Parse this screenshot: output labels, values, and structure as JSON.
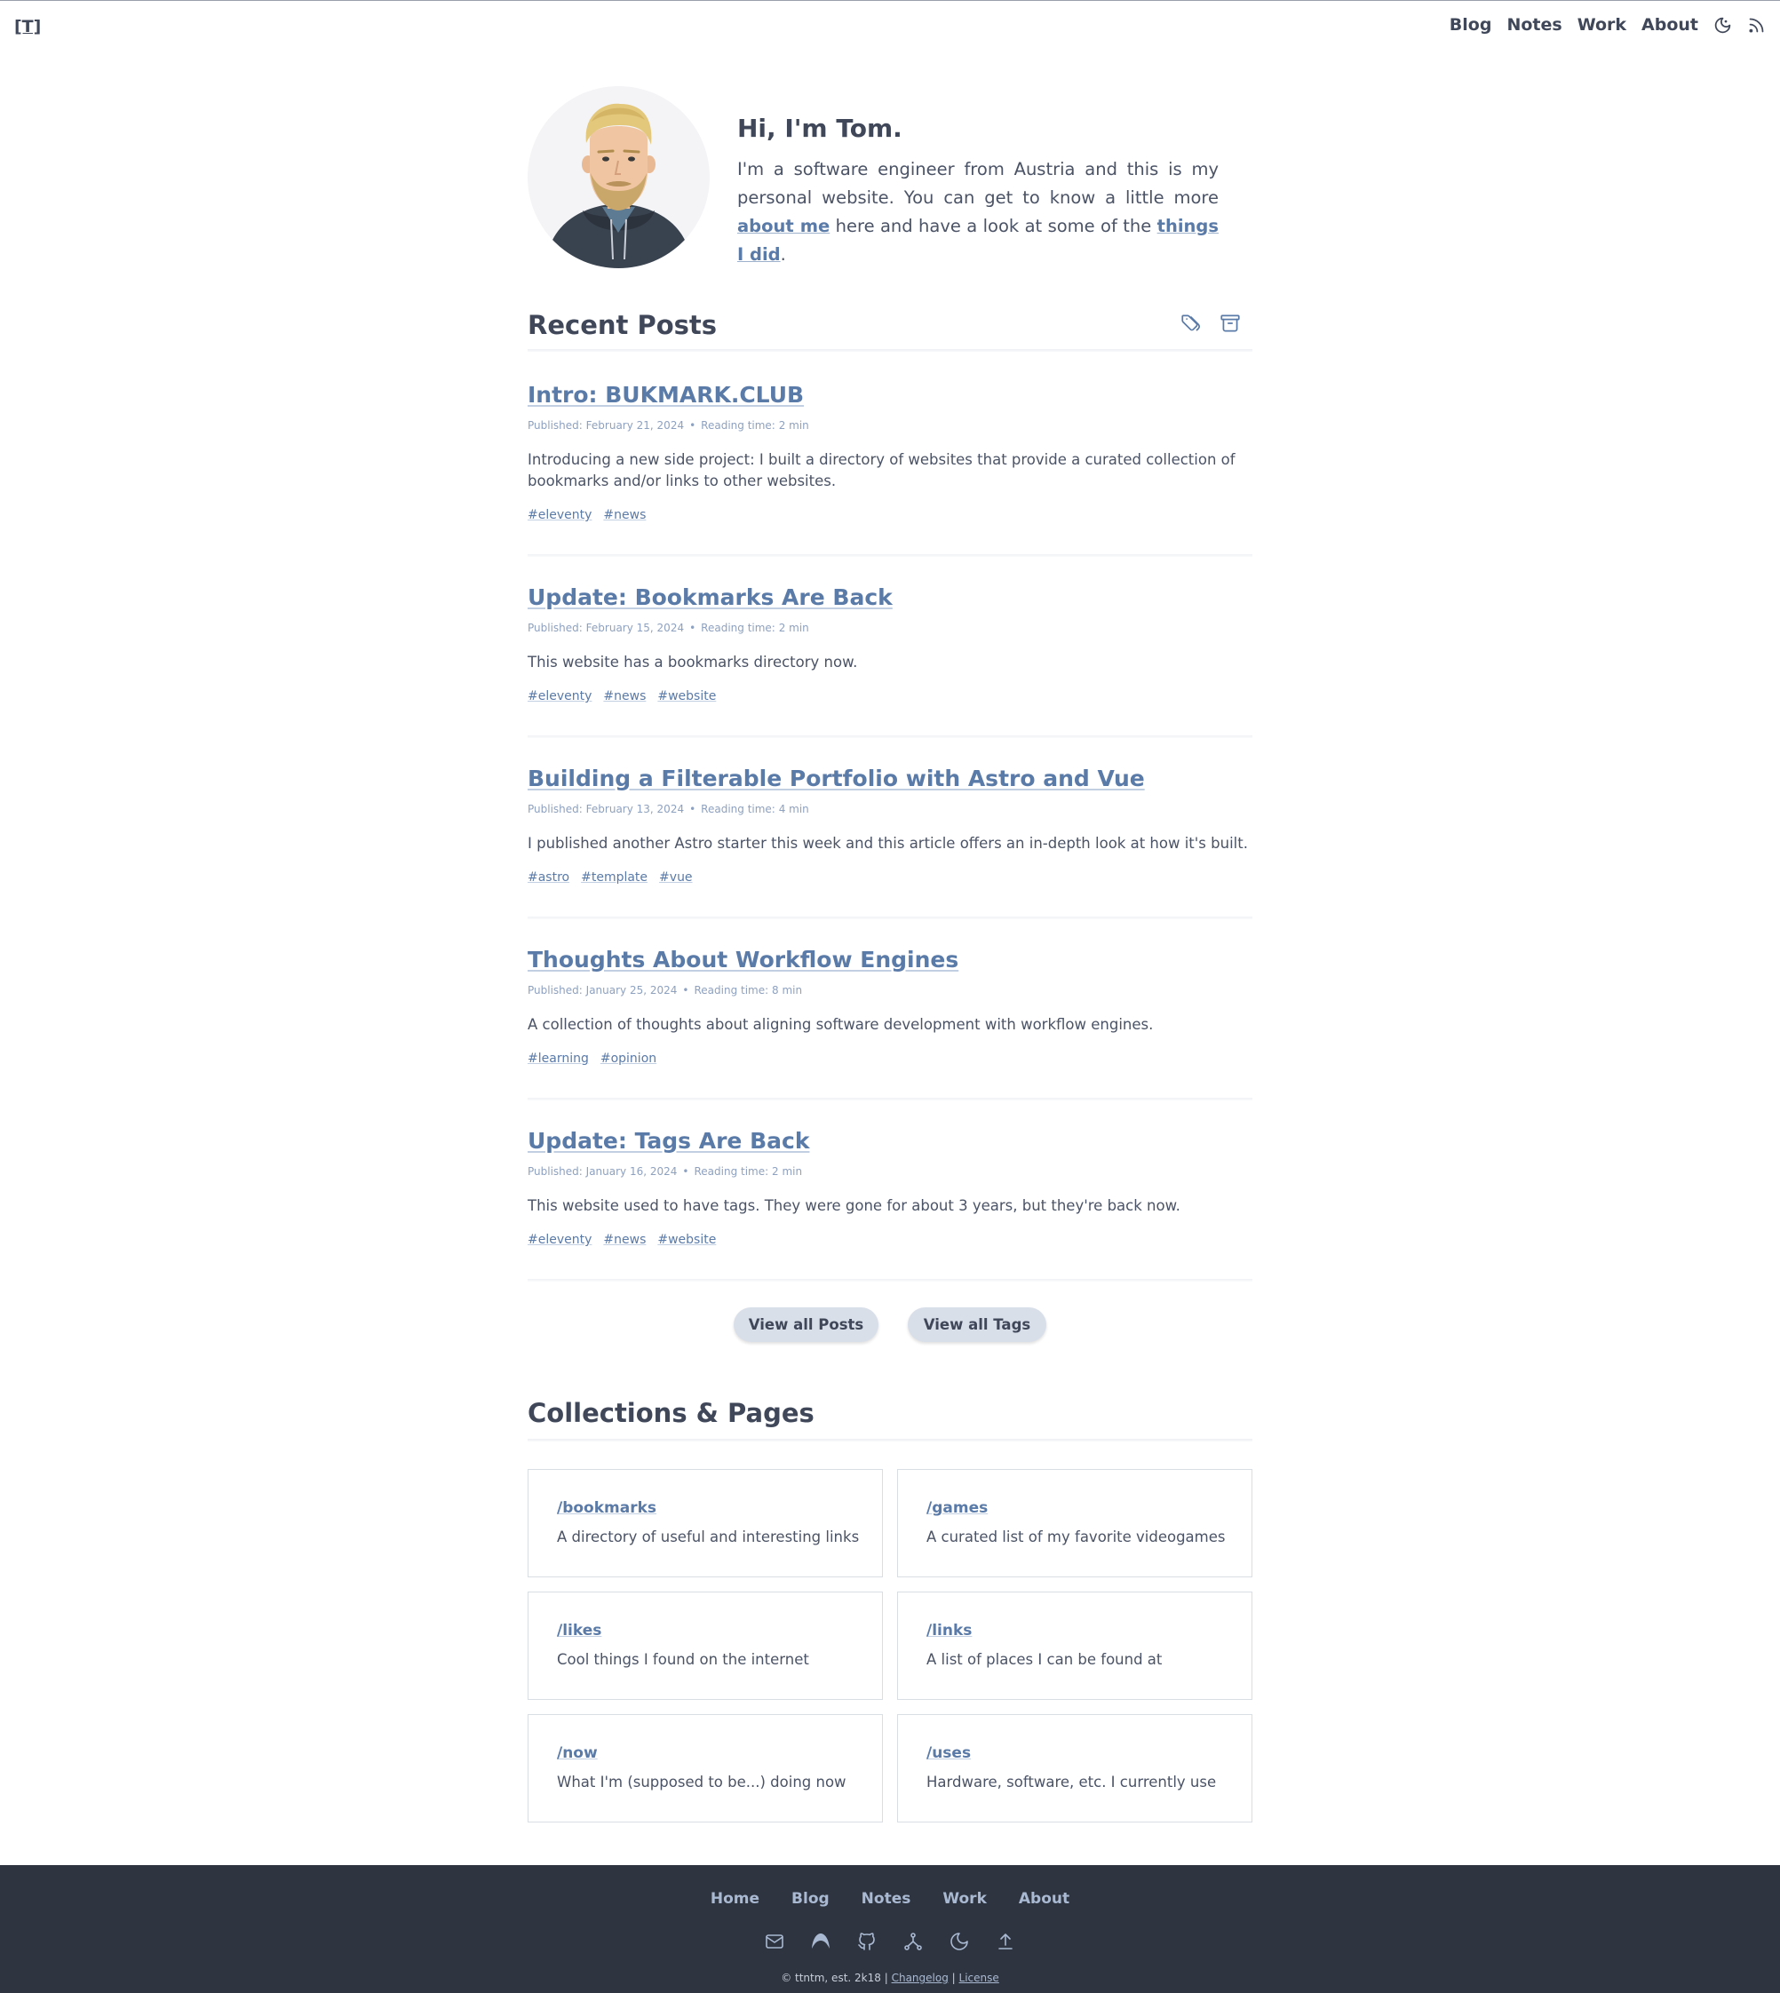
{
  "header": {
    "logo": "[T]",
    "nav": [
      "Blog",
      "Notes",
      "Work",
      "About"
    ],
    "icons": [
      "moon-icon",
      "rss-icon"
    ]
  },
  "intro": {
    "title": "Hi, I'm Tom.",
    "text_before": "I'm a software engineer from Austria and this is my personal website. You can get to know a little more ",
    "about_link": "about me",
    "text_middle": " here and have a look at some of the ",
    "work_link": "things I did",
    "text_end": "."
  },
  "recent": {
    "heading": "Recent Posts",
    "icons": [
      "tags-icon",
      "archive-icon"
    ],
    "published_prefix": "Published:",
    "reading_prefix": "Reading time:",
    "posts": [
      {
        "title": "Intro: BUKMARK.CLUB",
        "date": "February 21, 2024",
        "reading": "2 min",
        "desc": "Introducing a new side project: I built a directory of websites that provide a curated collection of bookmarks and/or links to other websites.",
        "tags": [
          "#eleventy",
          "#news"
        ]
      },
      {
        "title": "Update: Bookmarks Are Back",
        "date": "February 15, 2024",
        "reading": "2 min",
        "desc": "This website has a bookmarks directory now.",
        "tags": [
          "#eleventy",
          "#news",
          "#website"
        ]
      },
      {
        "title": "Building a Filterable Portfolio with Astro and Vue",
        "date": "February 13, 2024",
        "reading": "4 min",
        "desc": "I published another Astro starter this week and this article offers an in-depth look at how it's built.",
        "tags": [
          "#astro",
          "#template",
          "#vue"
        ]
      },
      {
        "title": "Thoughts About Workflow Engines",
        "date": "January 25, 2024",
        "reading": "8 min",
        "desc": "A collection of thoughts about aligning software development with workflow engines.",
        "tags": [
          "#learning",
          "#opinion"
        ]
      },
      {
        "title": "Update: Tags Are Back",
        "date": "January 16, 2024",
        "reading": "2 min",
        "desc": "This website used to have tags. They were gone for about 3 years, but they're back now.",
        "tags": [
          "#eleventy",
          "#news",
          "#website"
        ]
      }
    ],
    "buttons": {
      "posts": "View all Posts",
      "tags": "View all Tags"
    }
  },
  "collections": {
    "heading": "Collections & Pages",
    "cards": [
      {
        "title": "/bookmarks",
        "desc": "A directory of useful and interesting links"
      },
      {
        "title": "/games",
        "desc": "A curated list of my favorite videogames"
      },
      {
        "title": "/likes",
        "desc": "Cool things I found on the internet"
      },
      {
        "title": "/links",
        "desc": "A list of places I can be found at"
      },
      {
        "title": "/now",
        "desc": "What I'm (supposed to be...) doing now"
      },
      {
        "title": "/uses",
        "desc": "Hardware, software, etc. I currently use"
      }
    ]
  },
  "footer": {
    "nav": [
      "Home",
      "Blog",
      "Notes",
      "Work",
      "About"
    ],
    "icons": [
      "mail-icon",
      "arc-icon",
      "github-icon",
      "network-icon",
      "moon-icon",
      "arrow-up-icon"
    ],
    "copyright": "© ttntm, est. 2k18 |",
    "changelog": "Changelog",
    "sep": "|",
    "license": "License"
  },
  "colors": {
    "text": "#3f4759",
    "link": "#5a7aa8",
    "meta": "#8ea1bf",
    "button_bg": "#d9dfe9",
    "footer_bg": "#2e3440",
    "footer_link": "#a9b9d2"
  }
}
